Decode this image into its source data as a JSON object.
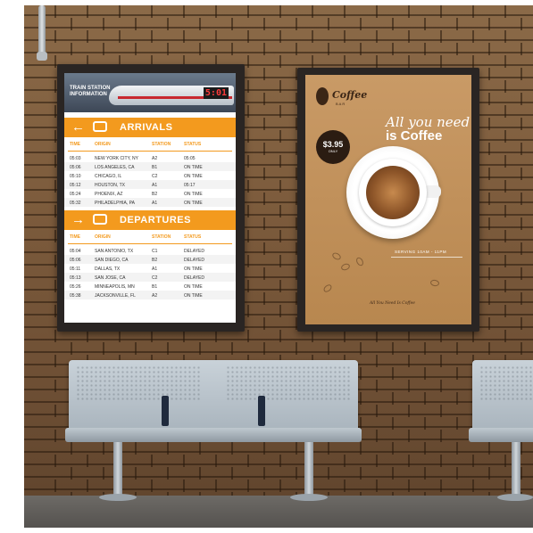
{
  "arrivals_board": {
    "banner_title": "TRAIN STATION INFORMATION",
    "banner_clock": "5:01",
    "arrivals_label": "ARRIVALS",
    "departures_label": "DEPARTURES",
    "headers": {
      "time": "TIME",
      "origin": "ORIGIN",
      "station": "STATION",
      "status": "STATUS"
    },
    "arrivals": [
      {
        "time": "05:03",
        "origin": "NEW YORK CITY, NY",
        "station": "A2",
        "status": "05:05"
      },
      {
        "time": "05:06",
        "origin": "LOS ANGELES, CA",
        "station": "B1",
        "status": "ON TIME"
      },
      {
        "time": "05:10",
        "origin": "CHICAGO, IL",
        "station": "C2",
        "status": "ON TIME"
      },
      {
        "time": "05:12",
        "origin": "HOUSTON, TX",
        "station": "A1",
        "status": "05:17"
      },
      {
        "time": "05:24",
        "origin": "PHOENIX, AZ",
        "station": "B2",
        "status": "ON TIME"
      },
      {
        "time": "05:32",
        "origin": "PHILADELPHIA, PA",
        "station": "A1",
        "status": "ON TIME"
      }
    ],
    "departures": [
      {
        "time": "05:04",
        "origin": "SAN ANTONIO, TX",
        "station": "C1",
        "status": "DELAYED"
      },
      {
        "time": "05:06",
        "origin": "SAN DIEGO, CA",
        "station": "B2",
        "status": "DELAYED"
      },
      {
        "time": "05:11",
        "origin": "DALLAS, TX",
        "station": "A1",
        "status": "ON TIME"
      },
      {
        "time": "05:13",
        "origin": "SAN JOSE, CA",
        "station": "C2",
        "status": "DELAYED"
      },
      {
        "time": "05:26",
        "origin": "MINNEAPOLIS, MN",
        "station": "B1",
        "status": "ON TIME"
      },
      {
        "time": "05:38",
        "origin": "JACKSONVILLE, FL",
        "station": "A2",
        "status": "ON TIME"
      }
    ]
  },
  "coffee_poster": {
    "logo": "Coffee",
    "logo_sub": "BAR",
    "tagline_1": "All you need",
    "tagline_2": "is Coffee",
    "price": "$3.95",
    "price_sub": "ONLY",
    "hours": "SERVING 10AM - 11PM",
    "signature": "All You Need Is Coffee"
  },
  "colors": {
    "accent": "#f39a1e",
    "poster_bg": "#c99a66",
    "bench": "#b8c2ca"
  }
}
